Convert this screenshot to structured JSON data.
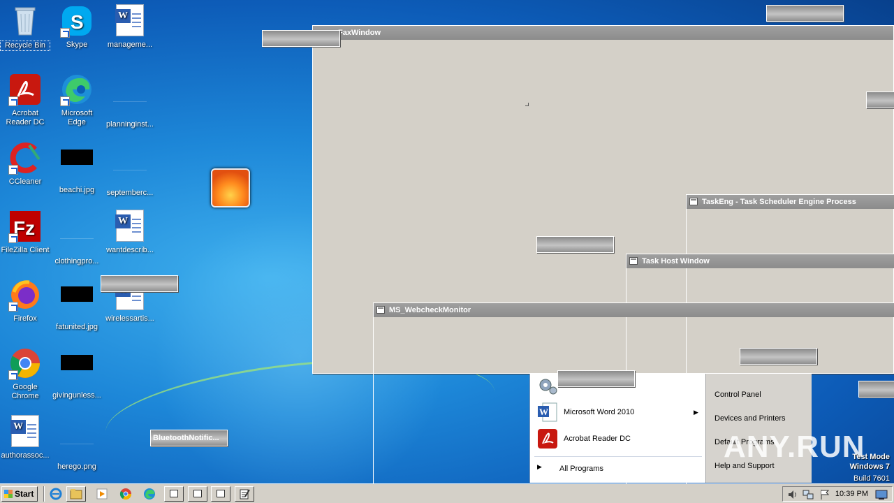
{
  "desktop": {
    "icons": [
      {
        "label": "Recycle Bin"
      },
      {
        "label": "Skype"
      },
      {
        "label": "manageme..."
      },
      {
        "label": "Acrobat Reader DC"
      },
      {
        "label": "Microsoft Edge"
      },
      {
        "label": "planninginst..."
      },
      {
        "label": "CCleaner"
      },
      {
        "label": "beachi.jpg"
      },
      {
        "label": "septemberc..."
      },
      {
        "label": "FileZilla Client"
      },
      {
        "label": "clothingpro..."
      },
      {
        "label": "wantdescrib..."
      },
      {
        "label": "Firefox"
      },
      {
        "label": "fatunited.jpg"
      },
      {
        "label": "wirelessartis..."
      },
      {
        "label": "Google Chrome"
      },
      {
        "label": "givingunless..."
      },
      {
        "label": "authorassoc..."
      },
      {
        "label": "herego.png"
      }
    ]
  },
  "windows": {
    "fax": {
      "title": "FaxWindow"
    },
    "taskeng": {
      "title": "TaskEng - Task Scheduler Engine Process"
    },
    "taskhost": {
      "title": "Task Host Window"
    },
    "webcheck": {
      "title": "MS_WebcheckMonitor"
    },
    "bluetooth": {
      "title": "BluetoothNotific..."
    }
  },
  "start_menu": {
    "left_items": [
      {
        "label": "Services",
        "icon": "gears-icon"
      },
      {
        "label": "Microsoft Word 2010",
        "icon": "word-icon"
      },
      {
        "label": "Acrobat Reader DC",
        "icon": "acrobat-icon"
      }
    ],
    "all_programs": "All Programs",
    "right_items": [
      {
        "label": "Control Panel"
      },
      {
        "label": "Devices and Printers"
      },
      {
        "label": "Default Programs"
      },
      {
        "label": "Help and Support"
      }
    ]
  },
  "taskbar": {
    "start_label": "Start",
    "clock": "10:39 PM"
  },
  "watermark": {
    "line1": "Test Mode",
    "line2": "Windows 7",
    "line3": "Build 7601",
    "anyrun": "ANY.RUN"
  },
  "colors": {
    "desktop_blue": "#1d87d8",
    "window_face": "#d4d0c8",
    "title_grey": "#8c8c8c"
  }
}
